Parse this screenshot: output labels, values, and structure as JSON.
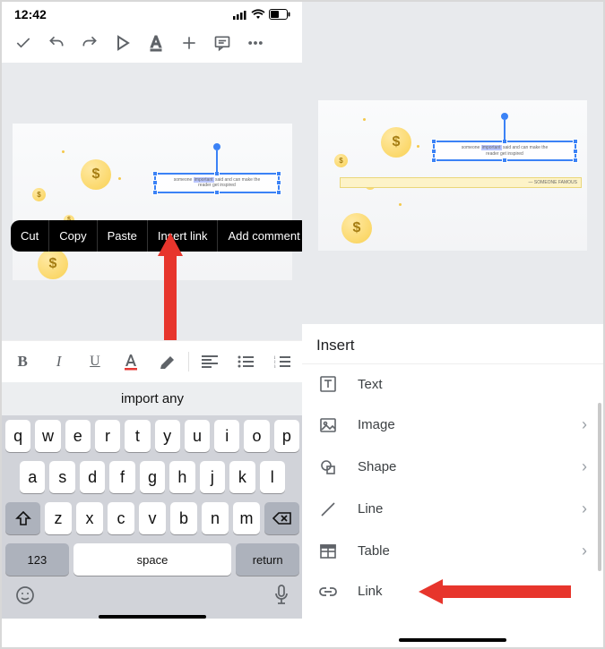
{
  "status": {
    "time": "12:42"
  },
  "context_menu": {
    "cut": "Cut",
    "copy": "Copy",
    "paste": "Paste",
    "insert_link": "Insert link",
    "add_comment": "Add comment"
  },
  "slide_text": {
    "line_start": "someone",
    "highlight": "important",
    "line_end": "said and can make the",
    "line2": "reader get inspired",
    "attrib": "— SOMEONE FAMOUS"
  },
  "keyboard": {
    "suggestion": "import any",
    "row1": [
      "q",
      "w",
      "e",
      "r",
      "t",
      "y",
      "u",
      "i",
      "o",
      "p"
    ],
    "row2": [
      "a",
      "s",
      "d",
      "f",
      "g",
      "h",
      "j",
      "k",
      "l"
    ],
    "row3": [
      "z",
      "x",
      "c",
      "v",
      "b",
      "n",
      "m"
    ],
    "numeric": "123",
    "space": "space",
    "return": "return"
  },
  "insert_panel": {
    "title": "Insert",
    "text": "Text",
    "image": "Image",
    "shape": "Shape",
    "line": "Line",
    "table": "Table",
    "link": "Link"
  }
}
